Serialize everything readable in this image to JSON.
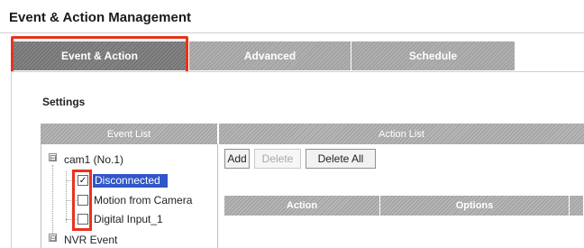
{
  "page": {
    "title": "Event & Action Management"
  },
  "tabs": [
    {
      "label": "Event & Action",
      "active": true
    },
    {
      "label": "Advanced"
    },
    {
      "label": "Schedule"
    }
  ],
  "settings": {
    "title": "Settings"
  },
  "event_list": {
    "header": "Event List",
    "groups": [
      {
        "label": "cam1 (No.1)",
        "expander": "⊟",
        "items": [
          {
            "label": "Disconnected",
            "checked": true,
            "selected": true
          },
          {
            "label": "Motion from Camera",
            "checked": false
          },
          {
            "label": "Digital Input_1",
            "checked": false
          }
        ]
      },
      {
        "label": "NVR Event",
        "expander": "⊟"
      }
    ]
  },
  "action_list": {
    "header": "Action List",
    "buttons": {
      "add": "Add",
      "delete": "Delete",
      "delete_all": "Delete All"
    },
    "columns": [
      "Action",
      "Options",
      ""
    ]
  },
  "colors": {
    "highlight": "#e8331e",
    "selection": "#3056c9"
  },
  "icons": {
    "checkbox_checked": "checkmark-icon",
    "expander": "minus-box-icon"
  }
}
